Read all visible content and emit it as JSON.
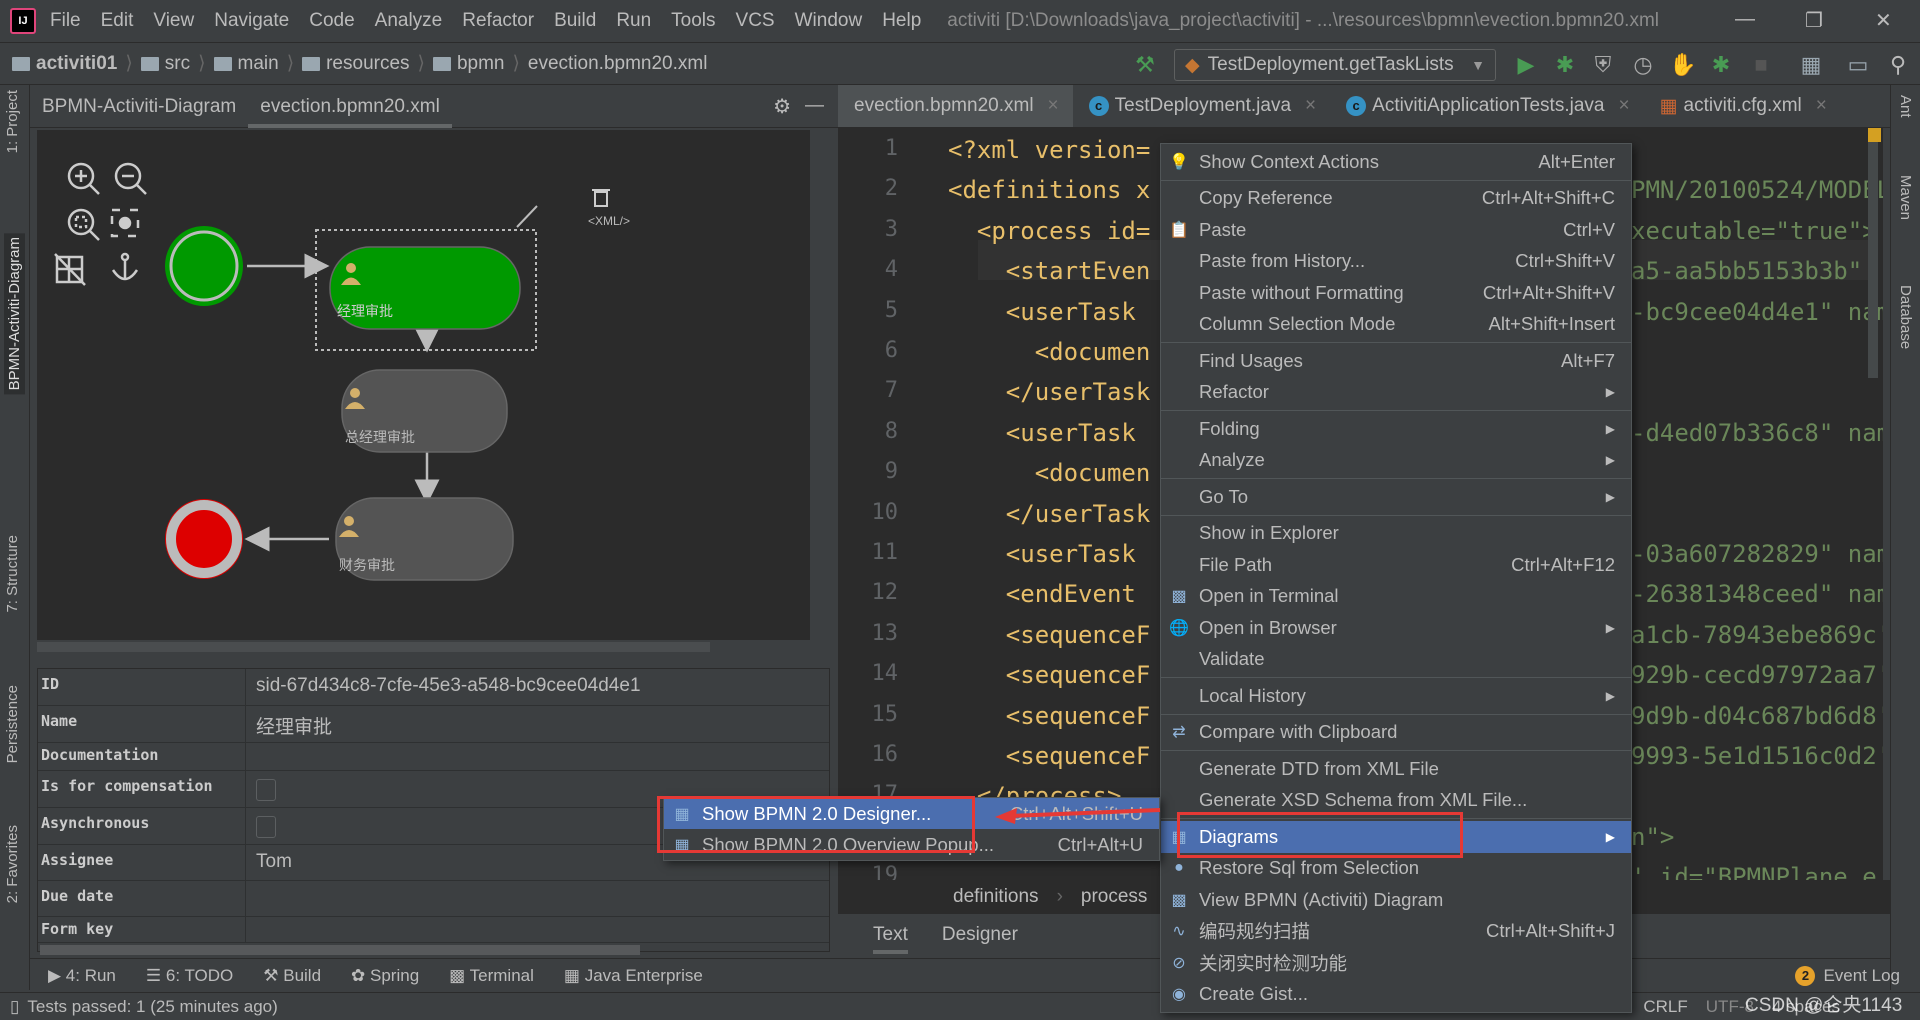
{
  "menubar": {
    "items": [
      "File",
      "Edit",
      "View",
      "Navigate",
      "Code",
      "Analyze",
      "Refactor",
      "Build",
      "Run",
      "Tools",
      "VCS",
      "Window",
      "Help"
    ],
    "window_title": "activiti [D:\\Downloads\\java_project\\activiti] - ...\\resources\\bpmn\\evection.bpmn20.xml"
  },
  "breadcrumb": [
    "activiti01",
    "src",
    "main",
    "resources",
    "bpmn",
    "evection.bpmn20.xml"
  ],
  "run_config": "TestDeployment.getTaskLists",
  "left_strip": {
    "project": "1: Project",
    "diagram": "BPMN-Activiti-Diagram",
    "structure": "7: Structure",
    "persistence": "Persistence",
    "favorites": "2: Favorites"
  },
  "right_strip": {
    "ant": "Ant",
    "maven": "Maven",
    "database": "Database"
  },
  "tool_window": {
    "tabs": [
      "BPMN-Activiti-Diagram",
      "evection.bpmn20.xml"
    ],
    "active_tab": 1
  },
  "diagram": {
    "tasks": [
      {
        "name": "经理审批",
        "selected": true,
        "color": "#009900"
      },
      {
        "name": "总经理审批",
        "color": "#545454"
      },
      {
        "name": "财务审批",
        "color": "#545454"
      }
    ],
    "start_color": "#009900",
    "end_color": "#dd0000",
    "xml_label": "<XML/>"
  },
  "properties": [
    {
      "key": "ID",
      "value": "sid-67d434c8-7cfe-45e3-a548-bc9cee04d4e1"
    },
    {
      "key": "Name",
      "value": "经理审批"
    },
    {
      "key": "Documentation",
      "value": ""
    },
    {
      "key": "Is for compensation",
      "checkbox": false
    },
    {
      "key": "Asynchronous",
      "checkbox": false
    },
    {
      "key": "Assignee",
      "value": "Tom"
    },
    {
      "key": "Due date",
      "value": ""
    },
    {
      "key": "Form key",
      "value": ""
    }
  ],
  "editor_tabs": [
    "evection.bpmn20.xml",
    "TestDeployment.java",
    "ActivitiApplicationTests.java",
    "activiti.cfg.xml"
  ],
  "code": {
    "left": [
      "<?xml version=",
      "<definitions x",
      "  <process id=",
      "    <startEven",
      "    <userTask",
      "      <documen",
      "    </userTask",
      "    <userTask",
      "      <documen",
      "    </userTask",
      "    <userTask",
      "    <endEvent",
      "    <sequenceF",
      "    <sequenceF",
      "    <sequenceF",
      "    <sequenceF",
      "  </process>"
    ],
    "right": [
      "",
      "PMN/20100524/MODEL",
      "xecutable=\"true\">",
      "a5-aa5bb5153b3b\"",
      "-bc9cee04d4e1\" nam",
      "",
      "",
      "-d4ed07b336c8\" nam",
      "",
      "",
      "-03a607282829\" nam",
      "-26381348ceed\" nam",
      "a1cb-78943ebe869c'",
      "929b-cecd97972aa7'",
      "9d9b-d04c687bd6d8'",
      "9993-5e1d1516c0d2'",
      "",
      "n\">",
      "' id=\"BPMNPlane_e"
    ]
  },
  "editor_breadcrumb": [
    "definitions",
    "process"
  ],
  "editor_modes": [
    "Text",
    "Designer"
  ],
  "context_menu": [
    {
      "label": "Show Context Actions",
      "shortcut": "Alt+Enter",
      "icon": "bulb-icon"
    },
    {
      "sep": true
    },
    {
      "label": "Copy Reference",
      "shortcut": "Ctrl+Alt+Shift+C"
    },
    {
      "label": "Paste",
      "shortcut": "Ctrl+V",
      "icon": "clipboard-icon"
    },
    {
      "label": "Paste from History...",
      "shortcut": "Ctrl+Shift+V"
    },
    {
      "label": "Paste without Formatting",
      "shortcut": "Ctrl+Alt+Shift+V"
    },
    {
      "label": "Column Selection Mode",
      "shortcut": "Alt+Shift+Insert"
    },
    {
      "sep": true
    },
    {
      "label": "Find Usages",
      "shortcut": "Alt+F7"
    },
    {
      "label": "Refactor",
      "submenu": true
    },
    {
      "sep": true
    },
    {
      "label": "Folding",
      "submenu": true
    },
    {
      "label": "Analyze",
      "submenu": true
    },
    {
      "sep": true
    },
    {
      "label": "Go To",
      "submenu": true
    },
    {
      "sep": true
    },
    {
      "label": "Show in Explorer"
    },
    {
      "label": "File Path",
      "shortcut": "Ctrl+Alt+F12"
    },
    {
      "label": "Open in Terminal",
      "icon": "terminal-icon"
    },
    {
      "label": "Open in Browser",
      "submenu": true,
      "icon": "globe-icon"
    },
    {
      "label": "Validate"
    },
    {
      "sep": true
    },
    {
      "label": "Local History",
      "submenu": true
    },
    {
      "sep": true
    },
    {
      "label": "Compare with Clipboard",
      "icon": "compare-icon"
    },
    {
      "sep": true
    },
    {
      "label": "Generate DTD from XML File"
    },
    {
      "label": "Generate XSD Schema from XML File..."
    },
    {
      "sep": true
    },
    {
      "label": "Diagrams",
      "submenu": true,
      "highlighted": true,
      "icon": "diagram-icon"
    },
    {
      "label": "Restore Sql from Selection",
      "icon": "sql-icon"
    },
    {
      "label": "View BPMN (Activiti) Diagram",
      "icon": "bpmn-icon"
    },
    {
      "label": "编码规约扫描",
      "shortcut": "Ctrl+Alt+Shift+J",
      "icon": "scan-icon"
    },
    {
      "label": "关闭实时检测功能",
      "icon": "block-icon"
    },
    {
      "label": "Create Gist...",
      "icon": "github-icon"
    }
  ],
  "submenu": [
    {
      "label": "Show BPMN 2.0 Designer...",
      "shortcut": "Ctrl+Alt+Shift+U",
      "highlighted": true
    },
    {
      "label": "Show BPMN 2.0 Overview Popup...",
      "shortcut": "Ctrl+Alt+U"
    }
  ],
  "bottom_tools": [
    "4: Run",
    "6: TODO",
    "Build",
    "Spring",
    "Terminal",
    "Java Enterprise"
  ],
  "event_log": {
    "count": "2",
    "label": "Event Log"
  },
  "status": {
    "message": "Tests passed: 1 (25 minutes ago)",
    "line_sep": "CRLF",
    "encoding": "UTF-8",
    "indent": "4 spaces"
  },
  "watermark": "CSDN @仑央1143",
  "colors": {
    "accent": "#4b6eaf",
    "annotation_red": "#e53935",
    "xml_tag": "#e8bf6a",
    "xml_string": "#6a8759"
  }
}
